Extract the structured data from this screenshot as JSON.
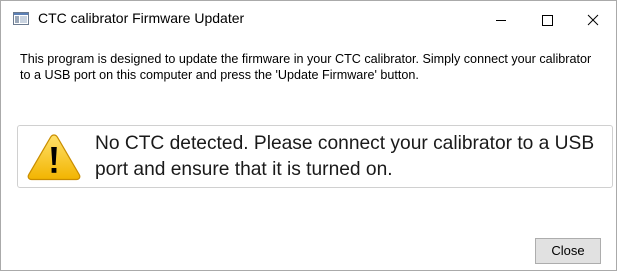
{
  "window": {
    "title": "CTC calibrator Firmware Updater",
    "app_icon": "app-window-icon",
    "caption_buttons": {
      "minimize_icon": "minimize-icon",
      "maximize_icon": "maximize-icon",
      "close_icon": "close-icon"
    }
  },
  "content": {
    "description": "This program is designed to update the firmware in your CTC calibrator.  Simply connect your calibrator to a USB port on this computer and press the 'Update Firmware' button.",
    "alert": {
      "icon": "warning-icon",
      "message": "No CTC detected.  Please connect your calibrator to a USB port and ensure that it is turned on.",
      "icon_color": "#f5c400"
    }
  },
  "footer": {
    "close_label": "Close"
  }
}
